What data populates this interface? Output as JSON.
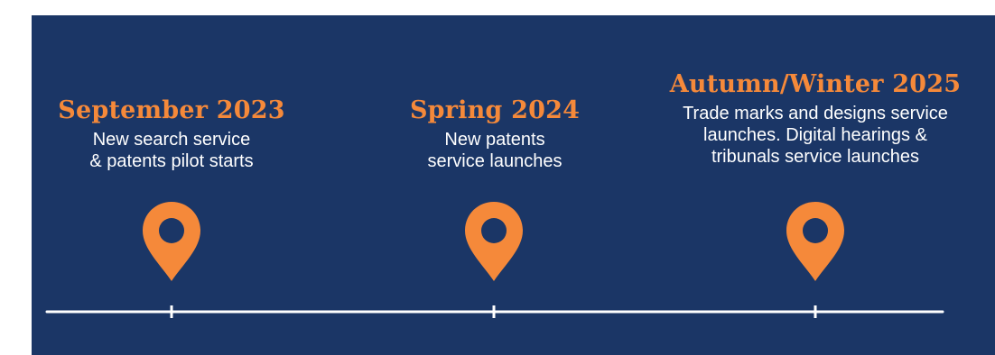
{
  "colors": {
    "background": "#1b3666",
    "accent": "#f5893a",
    "text": "#ffffff",
    "axis": "#ffffff"
  },
  "milestones": [
    {
      "title": "September 2023",
      "lines": [
        "New search service",
        "& patents pilot starts"
      ],
      "icon": "map-pin-icon"
    },
    {
      "title": "Spring 2024",
      "lines": [
        "New patents",
        "service launches"
      ],
      "icon": "map-pin-icon"
    },
    {
      "title": "Autumn/Winter 2025",
      "lines": [
        "Trade marks and designs service",
        "launches. Digital hearings &",
        "tribunals service launches"
      ],
      "icon": "map-pin-icon"
    }
  ]
}
